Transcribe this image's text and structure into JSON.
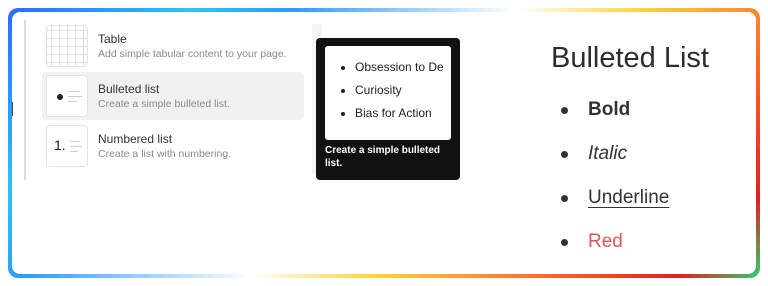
{
  "menu": {
    "items": [
      {
        "title": "Table",
        "desc": "Add simple tabular content to your page.",
        "icon": "table-icon"
      },
      {
        "title": "Bulleted list",
        "desc": "Create a simple bulleted list.",
        "icon": "bulleted-list-icon"
      },
      {
        "title": "Numbered list",
        "desc": "Create a list with numbering.",
        "icon": "numbered-list-icon",
        "number_glyph": "1."
      }
    ],
    "active_index": 1
  },
  "tooltip": {
    "preview_items": [
      "Obsession to De",
      "Curiosity",
      "Bias for Action"
    ],
    "caption": "Create a simple bulleted list."
  },
  "doc": {
    "title": "Bulleted List",
    "items": [
      "Bold",
      "Italic",
      "Underline",
      "Red"
    ],
    "colors": {
      "red": "#e0565b",
      "text": "#333333"
    }
  }
}
